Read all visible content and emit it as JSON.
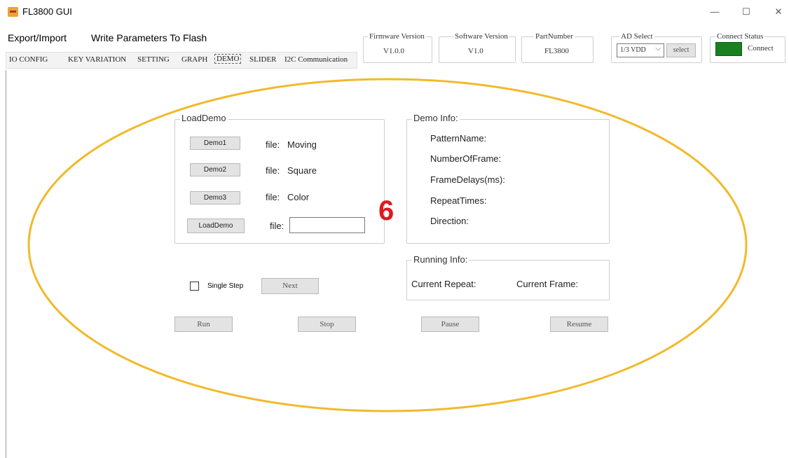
{
  "window": {
    "title": "FL3800 GUI",
    "minimize": "—",
    "maximize": "☐",
    "close": "✕"
  },
  "menu": {
    "export_import": "Export/Import",
    "write_flash": "Write Parameters To Flash"
  },
  "tabs": [
    "IO CONFIG",
    "KEY VARIATION",
    "SETTING",
    "GRAPH",
    "DEMO",
    "SLIDER",
    "I2C Communication"
  ],
  "active_tab": "DEMO",
  "info": {
    "firmware": {
      "label": "Firmware Version",
      "value": "V1.0.0"
    },
    "software": {
      "label": "Software Version",
      "value": "V1.0"
    },
    "part": {
      "label": "PartNumber",
      "value": "FL3800"
    },
    "ad": {
      "label": "AD Select",
      "value": "1/3 VDD",
      "button": "select"
    },
    "connect": {
      "label": "Connect Status",
      "value": "Connect",
      "color": "#1a7f1e"
    }
  },
  "load_demo": {
    "title": "LoadDemo",
    "rows": [
      {
        "button": "Demo1",
        "file_label": "file:",
        "file": "Moving"
      },
      {
        "button": "Demo2",
        "file_label": "file:",
        "file": "Square"
      },
      {
        "button": "Demo3",
        "file_label": "file:",
        "file": "Color"
      },
      {
        "button": "LoadDemo",
        "file_label": "file:",
        "file": ""
      }
    ]
  },
  "demo_info": {
    "title": "Demo Info:",
    "fields": [
      "PatternName:",
      "NumberOfFrame:",
      "FrameDelays(ms):",
      "RepeatTimes:",
      "Direction:"
    ]
  },
  "running_info": {
    "title": "Running Info:",
    "repeat": "Current Repeat:",
    "frame": "Current Frame:"
  },
  "controls": {
    "single_step": "Single Step",
    "next": "Next",
    "run": "Run",
    "stop": "Stop",
    "pause": "Pause",
    "resume": "Resume"
  },
  "annotation": {
    "number": "6",
    "circle_color": "#f2b92b",
    "number_color": "#e0181f"
  }
}
